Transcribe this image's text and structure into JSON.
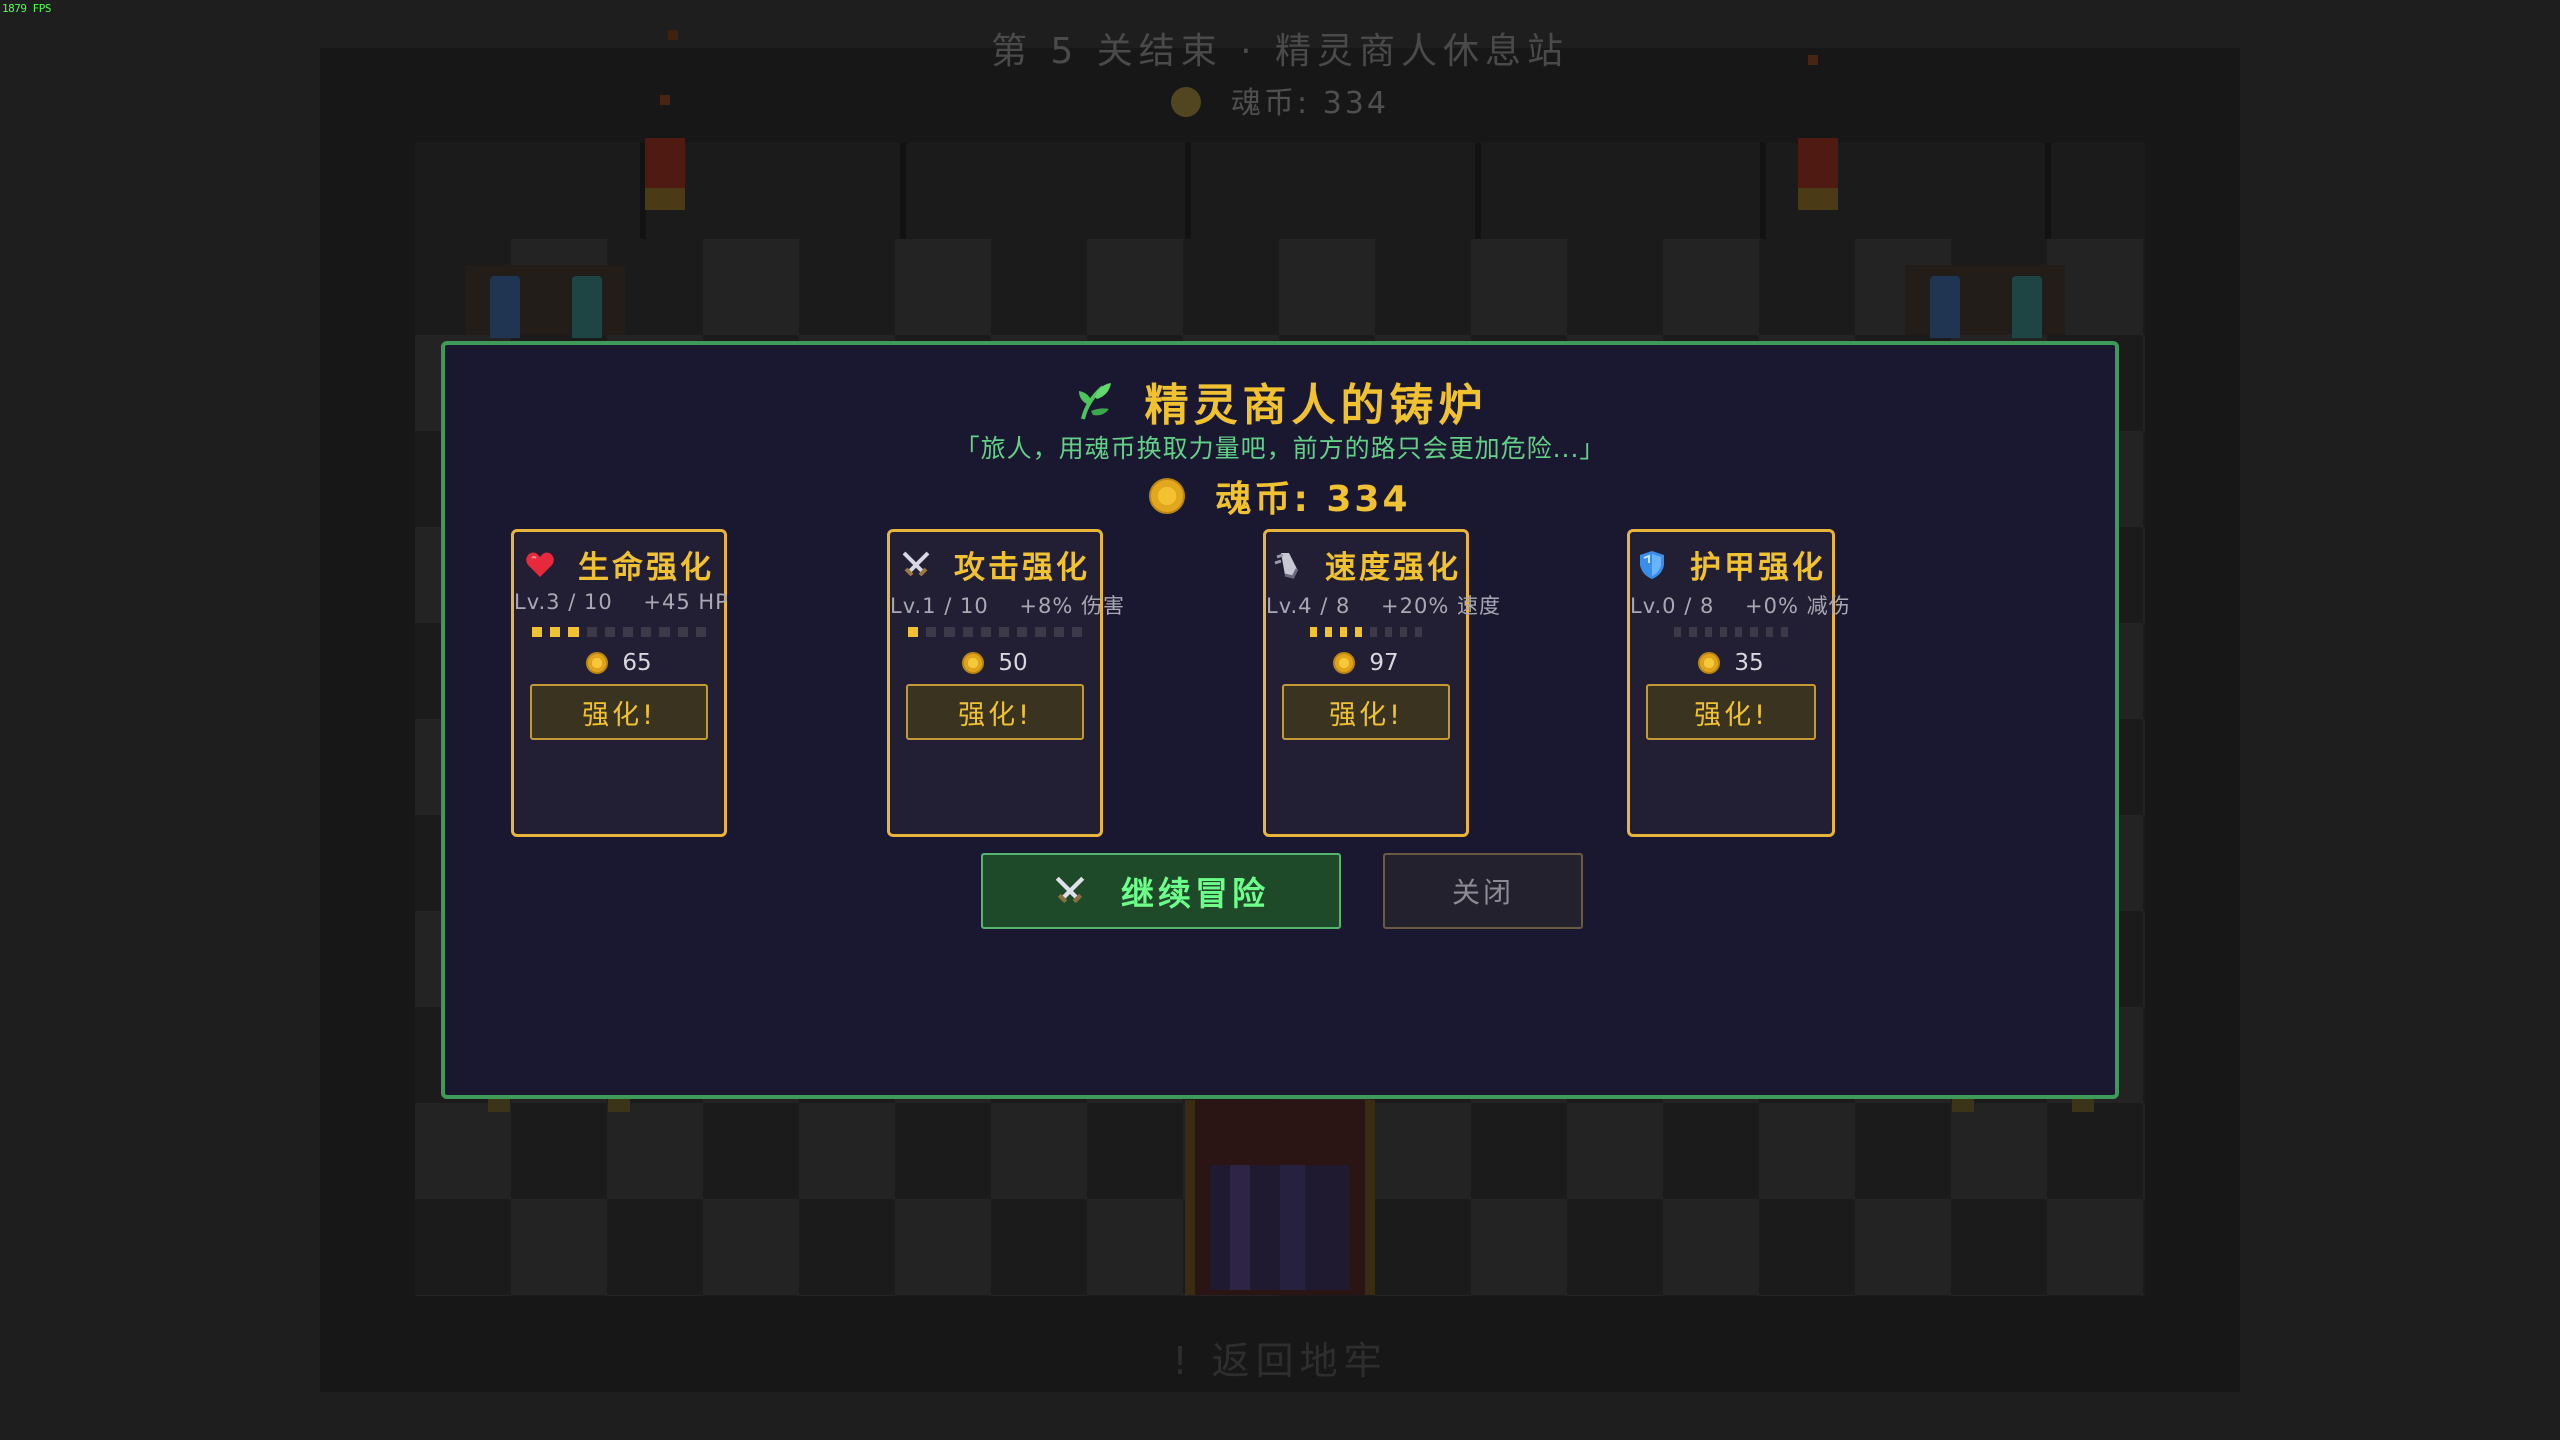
{
  "fps": "1879 FPS",
  "scene": {
    "title": "第 5 关结束 · 精灵商人休息站",
    "coins_label": "魂币: 334",
    "exit_hint": "! 返回地牢"
  },
  "shop": {
    "title": "精灵商人的铸炉",
    "subtitle": "「旅人，用魂币换取力量吧，前方的路只会更加危险...」",
    "coins_label": "魂币: 334",
    "coins": 334,
    "upgrades": [
      {
        "icon": "heart-icon",
        "title": "生命强化",
        "stats": "Lv.3 / 10    +45 HP",
        "level": 3,
        "max": 10,
        "cost": "65",
        "button": "强化!"
      },
      {
        "icon": "crossed-swords-icon",
        "title": "攻击强化",
        "stats": "Lv.1 / 10    +8% 伤害",
        "level": 1,
        "max": 10,
        "cost": "50",
        "button": "强化!"
      },
      {
        "icon": "boot-icon",
        "title": "速度强化",
        "stats": "Lv.4 / 8    +20% 速度",
        "level": 4,
        "max": 8,
        "cost": "97",
        "button": "强化!"
      },
      {
        "icon": "shield-icon",
        "title": "护甲强化",
        "stats": "Lv.0 / 8    +0% 减伤",
        "level": 0,
        "max": 8,
        "cost": "35",
        "button": "强化!"
      }
    ],
    "continue_button": "继续冒险",
    "close_button": "关闭"
  },
  "colors": {
    "accent_gold": "#f0c232",
    "accent_green": "#6dff8a",
    "modal_border": "#3f9a5a",
    "card_border": "#e9b43c"
  }
}
